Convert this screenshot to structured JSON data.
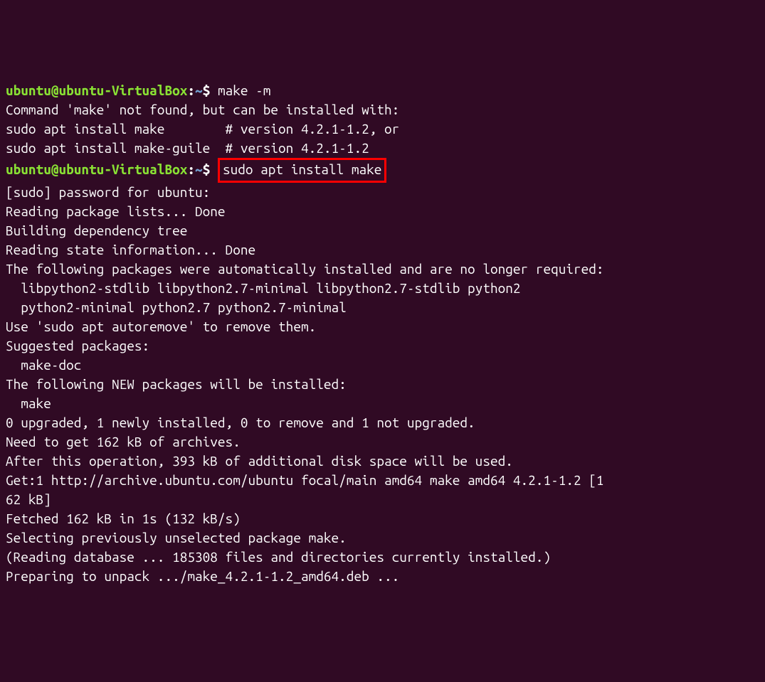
{
  "prompt1": {
    "user": "ubuntu@ubuntu-VirtualBox",
    "colon": ":",
    "path": "~",
    "dollar": "$ ",
    "command": "make -m"
  },
  "output1_lines": [
    "",
    "Command 'make' not found, but can be installed with:",
    "",
    "sudo apt install make        # version 4.2.1-1.2, or",
    "sudo apt install make-guile  # version 4.2.1-1.2",
    ""
  ],
  "prompt2": {
    "user": "ubuntu@ubuntu-VirtualBox",
    "colon": ":",
    "path": "~",
    "dollar": "$ ",
    "command": "sudo apt install make"
  },
  "output2_lines": [
    "[sudo] password for ubuntu:",
    "Reading package lists... Done",
    "Building dependency tree",
    "Reading state information... Done",
    "The following packages were automatically installed and are no longer required:",
    "  libpython2-stdlib libpython2.7-minimal libpython2.7-stdlib python2",
    "  python2-minimal python2.7 python2.7-minimal",
    "Use 'sudo apt autoremove' to remove them.",
    "Suggested packages:",
    "  make-doc",
    "The following NEW packages will be installed:",
    "  make",
    "0 upgraded, 1 newly installed, 0 to remove and 1 not upgraded.",
    "Need to get 162 kB of archives.",
    "After this operation, 393 kB of additional disk space will be used.",
    "Get:1 http://archive.ubuntu.com/ubuntu focal/main amd64 make amd64 4.2.1-1.2 [1",
    "62 kB]",
    "Fetched 162 kB in 1s (132 kB/s)",
    "Selecting previously unselected package make.",
    "(Reading database ... 185308 files and directories currently installed.)",
    "Preparing to unpack .../make_4.2.1-1.2_amd64.deb ..."
  ]
}
